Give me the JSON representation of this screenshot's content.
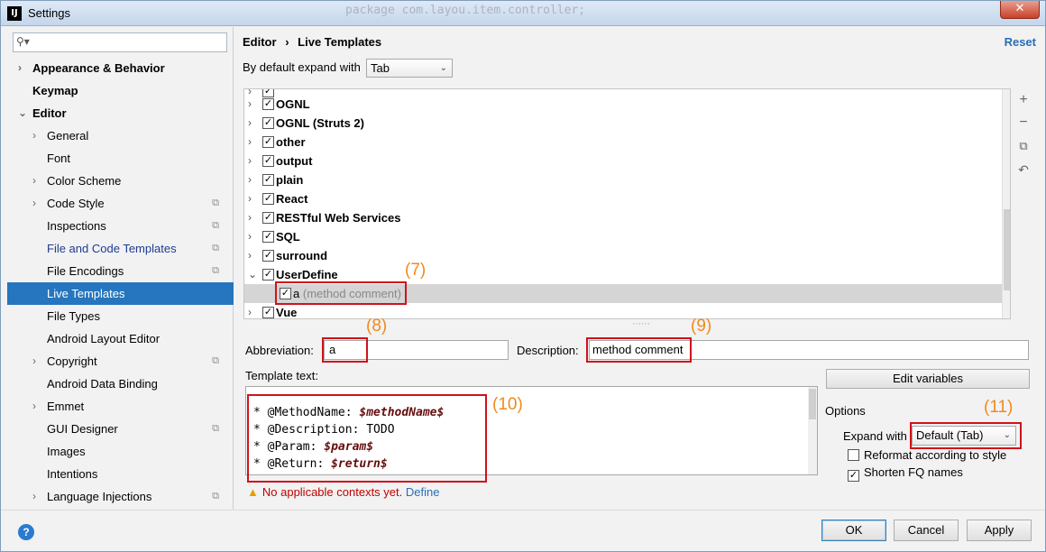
{
  "window": {
    "title": "Settings",
    "background_code": "package com.layou.item.controller;"
  },
  "sidebar": {
    "search_placeholder": "",
    "items": [
      {
        "label": "Appearance & Behavior"
      },
      {
        "label": "Keymap"
      },
      {
        "label": "Editor"
      },
      {
        "label": "General"
      },
      {
        "label": "Font"
      },
      {
        "label": "Color Scheme"
      },
      {
        "label": "Code Style"
      },
      {
        "label": "Inspections"
      },
      {
        "label": "File and Code Templates"
      },
      {
        "label": "File Encodings"
      },
      {
        "label": "Live Templates"
      },
      {
        "label": "File Types"
      },
      {
        "label": "Android Layout Editor"
      },
      {
        "label": "Copyright"
      },
      {
        "label": "Android Data Binding"
      },
      {
        "label": "Emmet"
      },
      {
        "label": "GUI Designer"
      },
      {
        "label": "Images"
      },
      {
        "label": "Intentions"
      },
      {
        "label": "Language Injections"
      }
    ]
  },
  "header": {
    "breadcrumb_parent": "Editor",
    "breadcrumb_sep": "›",
    "breadcrumb_current": "Live Templates",
    "reset": "Reset"
  },
  "expand_default": {
    "label": "By default expand with",
    "value": "Tab"
  },
  "template_groups": [
    {
      "label": "OGNL"
    },
    {
      "label": "OGNL (Struts 2)"
    },
    {
      "label": "other"
    },
    {
      "label": "output"
    },
    {
      "label": "plain"
    },
    {
      "label": "React"
    },
    {
      "label": "RESTful Web Services"
    },
    {
      "label": "SQL"
    },
    {
      "label": "surround"
    },
    {
      "label": "UserDefine"
    },
    {
      "label": "a",
      "desc": "(method comment)"
    },
    {
      "label": "Vue"
    }
  ],
  "editor": {
    "abbreviation_label": "Abbreviation:",
    "abbreviation_value": "a",
    "description_label": "Description:",
    "description_value": "method comment",
    "template_text_label": "Template text:",
    "lines": [
      {
        "prefix": "* @MethodName: ",
        "var": "$methodName$"
      },
      {
        "prefix": "* @Description: TODO",
        "var": ""
      },
      {
        "prefix": "* @Param: ",
        "var": "$param$"
      },
      {
        "prefix": "* @Return: ",
        "var": "$return$"
      }
    ],
    "warning": "No applicable contexts yet.",
    "define": "Define"
  },
  "options": {
    "edit_variables": "Edit variables",
    "title": "Options",
    "expand_with_label": "Expand with",
    "expand_with_value": "Default (Tab)",
    "reformat": "Reformat according to style",
    "shorten": "Shorten FQ names"
  },
  "footer": {
    "help": "?",
    "ok": "OK",
    "cancel": "Cancel",
    "apply": "Apply"
  },
  "annotations": [
    "(7)",
    "(8)",
    "(9)",
    "(10)",
    "(11)"
  ],
  "colors": {
    "selection": "#2675bf",
    "annotation_box": "#d0121b",
    "annotation_text": "#f08a1e",
    "link": "#2a6db5"
  }
}
